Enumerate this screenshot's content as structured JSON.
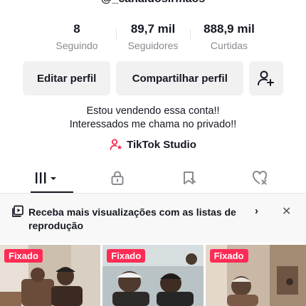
{
  "profile": {
    "username": "@_canaldosirmaos",
    "stats": [
      {
        "value": "8",
        "label": "Seguindo"
      },
      {
        "value": "89,7 mil",
        "label": "Seguidores"
      },
      {
        "value": "888,9 mil",
        "label": "Curtidas"
      }
    ],
    "bio_line1": "Estou vendendo essa conta!!",
    "bio_line2": "Interessados me chama no privado!!",
    "studio_label": "TikTok Studio"
  },
  "actions": {
    "edit_label": "Editar perfil",
    "share_label": "Compartilhar perfil",
    "add_friend_icon": "add-user-icon"
  },
  "tabs": [
    {
      "icon": "grid-icon",
      "active": true
    },
    {
      "icon": "lock-icon",
      "active": false
    },
    {
      "icon": "bookmark-icon",
      "active": false
    },
    {
      "icon": "liked-heart-icon",
      "active": false
    }
  ],
  "banner": {
    "text": "Receba mais visualizações com as listas de reprodução"
  },
  "videos": [
    {
      "badge": "Fixado"
    },
    {
      "badge": "Fixado"
    },
    {
      "badge": "Fixado"
    }
  ],
  "colors": {
    "accent": "#fe2c55",
    "text": "#161823",
    "muted": "#8a8b91",
    "button_bg": "#f1f1f2"
  }
}
